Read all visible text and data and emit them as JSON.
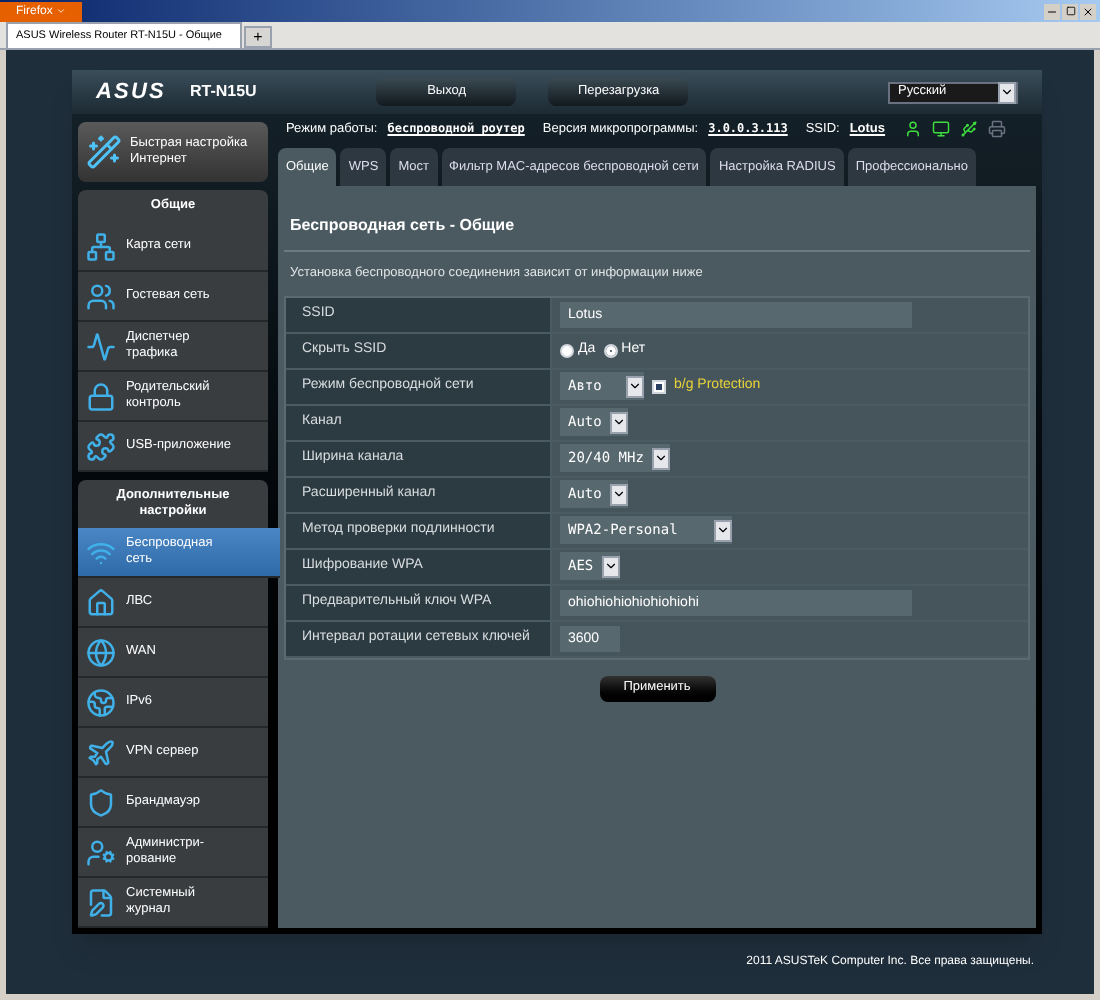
{
  "browser": {
    "menu_button": "Firefox",
    "tab_title": "ASUS Wireless Router RT-N15U - Общие",
    "new_tab": "+"
  },
  "header": {
    "logo": "ASUS",
    "model": "RT-N15U",
    "buttons": [
      "Выход",
      "Перезагрузка"
    ],
    "language": "Русский"
  },
  "status": {
    "mode_label": "Режим работы:",
    "mode_value": "беспроводной роутер",
    "firmware_label": "Версия микропрограммы:",
    "firmware_value": "3.0.0.3.113",
    "ssid_label": "SSID:",
    "ssid_value": "Lotus"
  },
  "quick_setup": "Быстрая настройка Интернет",
  "sidebar": {
    "sections": [
      {
        "title": "Общие",
        "items": [
          {
            "label": "Карта сети",
            "selected": false
          },
          {
            "label": "Гостевая сеть",
            "selected": false
          },
          {
            "label": "Диспетчер трафика",
            "selected": false
          },
          {
            "label": "Родительский контроль",
            "selected": false
          },
          {
            "label": "USB-приложение",
            "selected": false
          }
        ]
      },
      {
        "title": "Дополнительные настройки",
        "items": [
          {
            "label": "Беспроводная сеть",
            "selected": true
          },
          {
            "label": "ЛВС",
            "selected": false
          },
          {
            "label": "WAN",
            "selected": false
          },
          {
            "label": "IPv6",
            "selected": false
          },
          {
            "label": "VPN сервер",
            "selected": false
          },
          {
            "label": "Брандмауэр",
            "selected": false
          },
          {
            "label": "Администри-рование",
            "selected": false
          },
          {
            "label": "Системный журнал",
            "selected": false
          }
        ]
      }
    ]
  },
  "tabs": [
    {
      "label": "Общие",
      "selected": true
    },
    {
      "label": "WPS",
      "selected": false
    },
    {
      "label": "Мост",
      "selected": false
    },
    {
      "label": "Фильтр MAC-адресов беспроводной сети",
      "selected": false
    },
    {
      "label": "Настройка RADIUS",
      "selected": false
    },
    {
      "label": "Профессионально",
      "selected": false
    }
  ],
  "page_title": "Беспроводная сеть - Общие",
  "description": "Установка беспроводного соединения зависит от информации ниже",
  "settings": [
    {
      "kind": "text_wide",
      "label": "SSID",
      "value": "Lotus"
    },
    {
      "kind": "radio",
      "label": "Скрыть SSID",
      "options": [
        {
          "label": "Да",
          "selected": false
        },
        {
          "label": "Нет",
          "selected": true
        }
      ]
    },
    {
      "kind": "select_check",
      "label": "Режим беспроводной сети",
      "value": "Авто",
      "check_label": "b/g Protection",
      "checked": true
    },
    {
      "kind": "select",
      "label": "Канал",
      "value": "Auto"
    },
    {
      "kind": "select",
      "label": "Ширина канала",
      "value": "20/40 MHz"
    },
    {
      "kind": "select",
      "label": "Расширенный канал",
      "value": "Auto"
    },
    {
      "kind": "select_wide",
      "label": "Метод проверки подлинности",
      "value": "WPA2-Personal"
    },
    {
      "kind": "select",
      "label": "Шифрование WPA",
      "value": "AES"
    },
    {
      "kind": "text_wide",
      "label": "Предварительный ключ WPA",
      "value": "ohiohiohiohiohiohiohi"
    },
    {
      "kind": "text_narrow",
      "label": "Интервал ротации сетевых ключей",
      "value": "3600"
    }
  ],
  "apply_button": "Применить",
  "footer": "2011 ASUSTeK Computer Inc. Все права защищены."
}
